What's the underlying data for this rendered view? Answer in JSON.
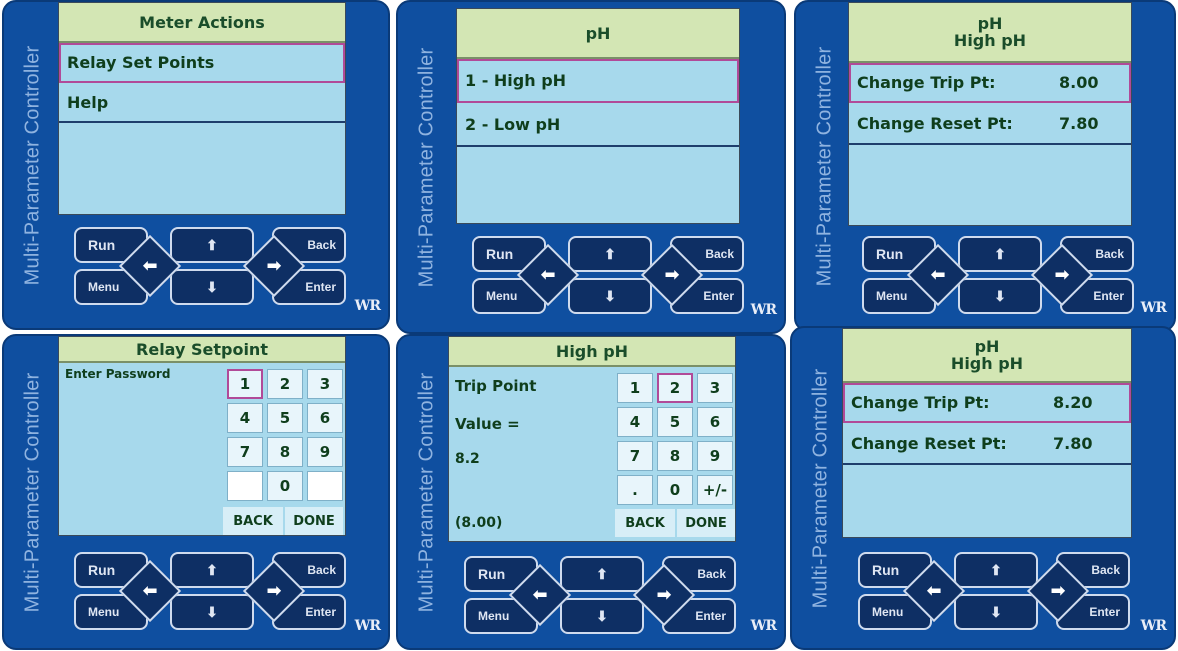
{
  "side_label": "Multi-Parameter Controller",
  "logo": "WR",
  "controls": {
    "run": "Run",
    "back": "Back",
    "menu": "Menu",
    "enter": "Enter",
    "up": "⬆",
    "down": "⬇",
    "left": "⬅",
    "right": "➡"
  },
  "panels": [
    {
      "title": "Meter Actions",
      "items": [
        {
          "label": "Relay Set Points",
          "value": "",
          "selected": true
        },
        {
          "label": "Help",
          "value": "",
          "selected": false
        }
      ]
    },
    {
      "title": "pH",
      "items": [
        {
          "label": "1 - High pH",
          "value": "",
          "selected": true
        },
        {
          "label": "2 - Low pH",
          "value": "",
          "selected": false
        }
      ]
    },
    {
      "title": "pH",
      "subtitle": "High pH",
      "items": [
        {
          "label": "Change Trip Pt:",
          "value": "8.00",
          "selected": true
        },
        {
          "label": "Change Reset Pt:",
          "value": "7.80",
          "selected": false
        }
      ]
    },
    {
      "title": "Relay Setpoint",
      "prompt": "Enter Password",
      "keys": [
        "1",
        "2",
        "3",
        "4",
        "5",
        "6",
        "7",
        "8",
        "9",
        "",
        "0",
        ""
      ],
      "selected_key": "1",
      "back": "BACK",
      "done": "DONE"
    },
    {
      "title": "High pH",
      "field_label": "Trip Point",
      "value_label": "Value =",
      "value": "8.2",
      "previous": "(8.00)",
      "keys": [
        "1",
        "2",
        "3",
        "4",
        "5",
        "6",
        "7",
        "8",
        "9",
        ".",
        "0",
        "+/-"
      ],
      "selected_key": "2",
      "back": "BACK",
      "done": "DONE"
    },
    {
      "title": "pH",
      "subtitle": "High pH",
      "items": [
        {
          "label": "Change Trip Pt:",
          "value": "8.20",
          "selected": true
        },
        {
          "label": "Change Reset Pt:",
          "value": "7.80",
          "selected": false
        }
      ]
    }
  ]
}
